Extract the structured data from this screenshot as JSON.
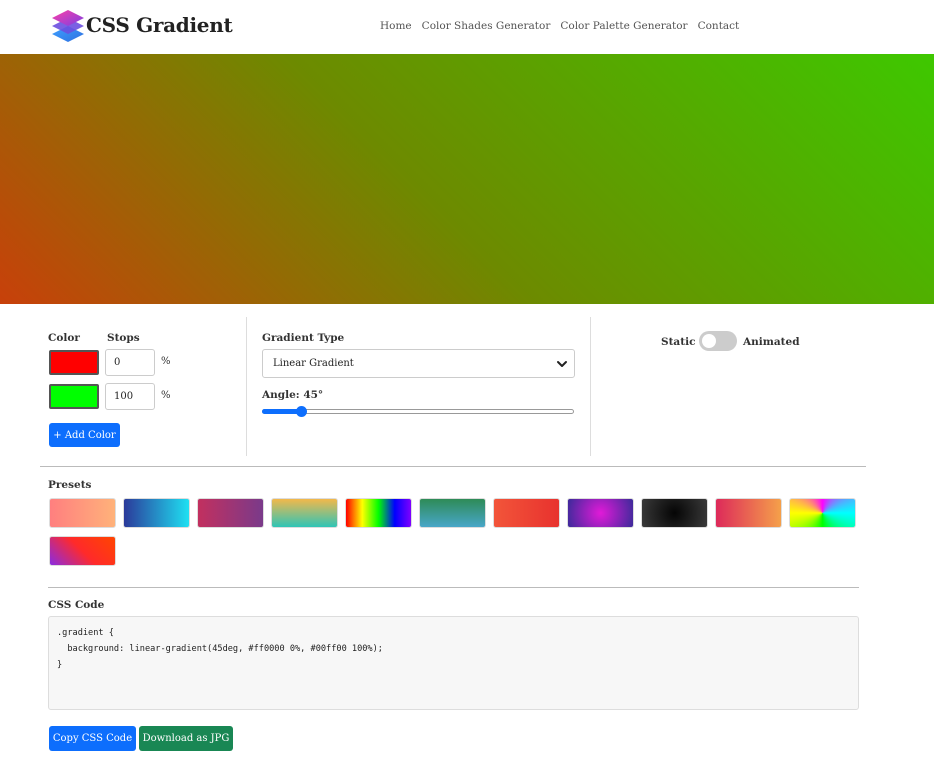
{
  "header": {
    "brand": "CSS Gradient",
    "nav": [
      "Home",
      "Color Shades Generator",
      "Color Palette Generator",
      "Contact"
    ]
  },
  "preview": {
    "angle_deg": 45,
    "color_from": "#ff0000",
    "color_to": "#00ff00"
  },
  "stops_panel": {
    "color_label": "Color",
    "stops_label": "Stops",
    "stops": [
      {
        "color": "#ff0000",
        "value": "0",
        "unit": "%"
      },
      {
        "color": "#00ff00",
        "value": "100",
        "unit": "%"
      }
    ],
    "add_button": "+ Add Color"
  },
  "gradient_panel": {
    "type_label": "Gradient Type",
    "type_value": "Linear Gradient",
    "angle_label": "Angle: 45°",
    "angle_value": 45,
    "angle_max": 360
  },
  "mode_panel": {
    "static_label": "Static",
    "animated_label": "Animated",
    "animated_on": false
  },
  "presets": {
    "title": "Presets",
    "items": [
      "linear-gradient(90deg, #ff7f7f, #ffb27a)",
      "linear-gradient(90deg, #2b3a9a, #1fe0f2)",
      "linear-gradient(90deg, #c2305f, #7a3a8a)",
      "linear-gradient(180deg, #f2b84b, #2ec4b6)",
      "linear-gradient(90deg, #ff0000, #ffff00, #00ff00, #0000ff, #8000ff)",
      "linear-gradient(180deg, #2e8b57, #48a6c8)",
      "linear-gradient(90deg, #f2553a, #e8322e)",
      "radial-gradient(circle, #e11ad8, #3b2a9a)",
      "radial-gradient(circle, #050505, #3a3a3a)",
      "linear-gradient(90deg, #dd2a5a, #f5a04a)",
      "conic-gradient(from 0deg, #ff00ff, #00ffff, #00ff00, #ffff00, #ff00ff)",
      "linear-gradient(45deg, #8a2be2, #ff2a2a, #ff4500)"
    ]
  },
  "css_code": {
    "title": "CSS Code",
    "lines": [
      ".gradient {",
      "  background: linear-gradient(45deg, #ff0000 0%, #00ff00 100%);",
      "}"
    ]
  },
  "actions": {
    "copy_label": "Copy CSS Code",
    "download_label": "Download as JPG"
  }
}
